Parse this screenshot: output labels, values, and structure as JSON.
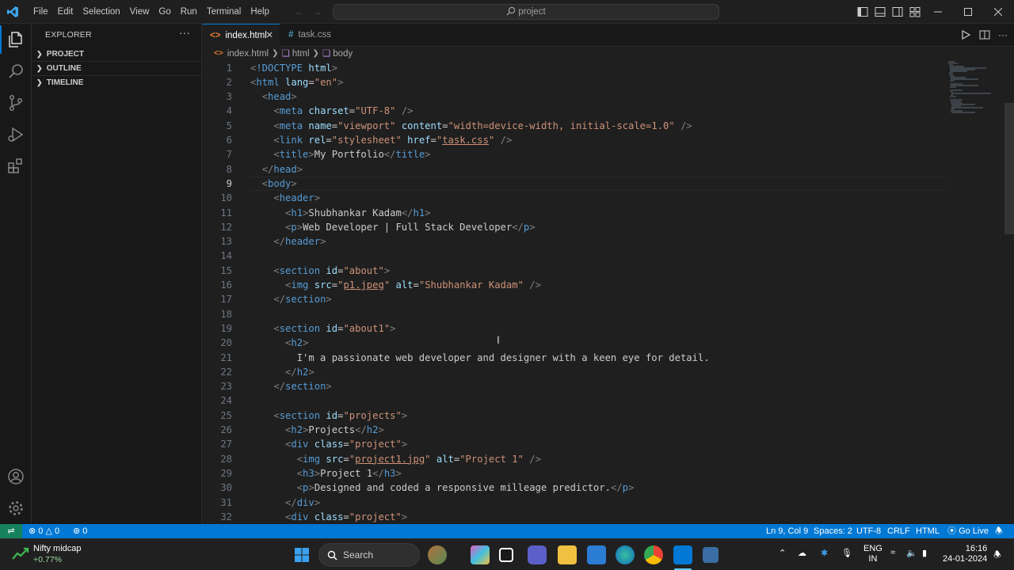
{
  "titlebar": {
    "menu": [
      "File",
      "Edit",
      "Selection",
      "View",
      "Go",
      "Run",
      "Terminal",
      "Help"
    ],
    "search": "project",
    "icons": [
      "vscode-logo",
      "back-arrow-icon",
      "forward-arrow-icon",
      "toggle-sidebar-icon",
      "toggle-panel-icon",
      "toggle-secondary-sidebar-icon",
      "customize-layout-icon",
      "minimize-icon",
      "maximize-icon",
      "close-icon"
    ]
  },
  "activitybar": {
    "items": [
      "explorer-icon",
      "search-icon",
      "source-control-icon",
      "run-debug-icon",
      "extensions-icon"
    ],
    "bottom": [
      "accounts-icon",
      "manage-gear-icon"
    ]
  },
  "sidebar": {
    "title": "EXPLORER",
    "more": "···",
    "sections": [
      "PROJECT",
      "OUTLINE",
      "TIMELINE"
    ]
  },
  "tabs": [
    {
      "label": "index.html",
      "icon": "<>",
      "active": true,
      "close": "✕"
    },
    {
      "label": "task.css",
      "icon": "#",
      "active": false
    }
  ],
  "breadcrumb": [
    "index.html",
    "html",
    "body"
  ],
  "editor": {
    "current_line": 9,
    "lines": [
      [
        [
          "b",
          "<"
        ],
        [
          "t",
          "!DOCTYPE"
        ],
        [
          "p",
          " "
        ],
        [
          "a",
          "html"
        ],
        [
          "b",
          ">"
        ]
      ],
      [
        [
          "b",
          "<"
        ],
        [
          "t",
          "html"
        ],
        [
          "p",
          " "
        ],
        [
          "a",
          "lang"
        ],
        [
          "p",
          "="
        ],
        [
          "s",
          "\"en\""
        ],
        [
          "b",
          ">"
        ]
      ],
      [
        [
          "p",
          "  "
        ],
        [
          "b",
          "<"
        ],
        [
          "t",
          "head"
        ],
        [
          "b",
          ">"
        ]
      ],
      [
        [
          "p",
          "    "
        ],
        [
          "b",
          "<"
        ],
        [
          "t",
          "meta"
        ],
        [
          "p",
          " "
        ],
        [
          "a",
          "charset"
        ],
        [
          "p",
          "="
        ],
        [
          "s",
          "\"UTF-8\""
        ],
        [
          "p",
          " "
        ],
        [
          "b",
          "/>"
        ]
      ],
      [
        [
          "p",
          "    "
        ],
        [
          "b",
          "<"
        ],
        [
          "t",
          "meta"
        ],
        [
          "p",
          " "
        ],
        [
          "a",
          "name"
        ],
        [
          "p",
          "="
        ],
        [
          "s",
          "\"viewport\""
        ],
        [
          "p",
          " "
        ],
        [
          "a",
          "content"
        ],
        [
          "p",
          "="
        ],
        [
          "s",
          "\"width=device-width, initial-scale=1.0\""
        ],
        [
          "p",
          " "
        ],
        [
          "b",
          "/>"
        ]
      ],
      [
        [
          "p",
          "    "
        ],
        [
          "b",
          "<"
        ],
        [
          "t",
          "link"
        ],
        [
          "p",
          " "
        ],
        [
          "a",
          "rel"
        ],
        [
          "p",
          "="
        ],
        [
          "s",
          "\"stylesheet\""
        ],
        [
          "p",
          " "
        ],
        [
          "a",
          "href"
        ],
        [
          "p",
          "="
        ],
        [
          "s",
          "\""
        ],
        [
          "su",
          "task.css"
        ],
        [
          "s",
          "\""
        ],
        [
          "p",
          " "
        ],
        [
          "b",
          "/>"
        ]
      ],
      [
        [
          "p",
          "    "
        ],
        [
          "b",
          "<"
        ],
        [
          "t",
          "title"
        ],
        [
          "b",
          ">"
        ],
        [
          "p",
          "My Portfolio"
        ],
        [
          "b",
          "</"
        ],
        [
          "t",
          "title"
        ],
        [
          "b",
          ">"
        ]
      ],
      [
        [
          "p",
          "  "
        ],
        [
          "b",
          "</"
        ],
        [
          "t",
          "head"
        ],
        [
          "b",
          ">"
        ]
      ],
      [
        [
          "p",
          "  "
        ],
        [
          "b",
          "<"
        ],
        [
          "t",
          "body"
        ],
        [
          "b",
          ">"
        ]
      ],
      [
        [
          "p",
          "    "
        ],
        [
          "b",
          "<"
        ],
        [
          "t",
          "header"
        ],
        [
          "b",
          ">"
        ]
      ],
      [
        [
          "p",
          "      "
        ],
        [
          "b",
          "<"
        ],
        [
          "t",
          "h1"
        ],
        [
          "b",
          ">"
        ],
        [
          "p",
          "Shubhankar Kadam"
        ],
        [
          "b",
          "</"
        ],
        [
          "t",
          "h1"
        ],
        [
          "b",
          ">"
        ]
      ],
      [
        [
          "p",
          "      "
        ],
        [
          "b",
          "<"
        ],
        [
          "t",
          "p"
        ],
        [
          "b",
          ">"
        ],
        [
          "p",
          "Web Developer | Full Stack Developer"
        ],
        [
          "b",
          "</"
        ],
        [
          "t",
          "p"
        ],
        [
          "b",
          ">"
        ]
      ],
      [
        [
          "p",
          "    "
        ],
        [
          "b",
          "</"
        ],
        [
          "t",
          "header"
        ],
        [
          "b",
          ">"
        ]
      ],
      [],
      [
        [
          "p",
          "    "
        ],
        [
          "b",
          "<"
        ],
        [
          "t",
          "section"
        ],
        [
          "p",
          " "
        ],
        [
          "a",
          "id"
        ],
        [
          "p",
          "="
        ],
        [
          "s",
          "\"about\""
        ],
        [
          "b",
          ">"
        ]
      ],
      [
        [
          "p",
          "      "
        ],
        [
          "b",
          "<"
        ],
        [
          "t",
          "img"
        ],
        [
          "p",
          " "
        ],
        [
          "a",
          "src"
        ],
        [
          "p",
          "="
        ],
        [
          "s",
          "\""
        ],
        [
          "su",
          "p1.jpeg"
        ],
        [
          "s",
          "\""
        ],
        [
          "p",
          " "
        ],
        [
          "a",
          "alt"
        ],
        [
          "p",
          "="
        ],
        [
          "s",
          "\"Shubhankar Kadam\""
        ],
        [
          "p",
          " "
        ],
        [
          "b",
          "/>"
        ]
      ],
      [
        [
          "p",
          "    "
        ],
        [
          "b",
          "</"
        ],
        [
          "t",
          "section"
        ],
        [
          "b",
          ">"
        ]
      ],
      [],
      [
        [
          "p",
          "    "
        ],
        [
          "b",
          "<"
        ],
        [
          "t",
          "section"
        ],
        [
          "p",
          " "
        ],
        [
          "a",
          "id"
        ],
        [
          "p",
          "="
        ],
        [
          "s",
          "\"about1\""
        ],
        [
          "b",
          ">"
        ]
      ],
      [
        [
          "p",
          "      "
        ],
        [
          "b",
          "<"
        ],
        [
          "t",
          "h2"
        ],
        [
          "b",
          ">"
        ]
      ],
      [
        [
          "p",
          "        I'm a passionate web developer and designer with a keen eye for detail."
        ]
      ],
      [
        [
          "p",
          "      "
        ],
        [
          "b",
          "</"
        ],
        [
          "t",
          "h2"
        ],
        [
          "b",
          ">"
        ]
      ],
      [
        [
          "p",
          "    "
        ],
        [
          "b",
          "</"
        ],
        [
          "t",
          "section"
        ],
        [
          "b",
          ">"
        ]
      ],
      [],
      [
        [
          "p",
          "    "
        ],
        [
          "b",
          "<"
        ],
        [
          "t",
          "section"
        ],
        [
          "p",
          " "
        ],
        [
          "a",
          "id"
        ],
        [
          "p",
          "="
        ],
        [
          "s",
          "\"projects\""
        ],
        [
          "b",
          ">"
        ]
      ],
      [
        [
          "p",
          "      "
        ],
        [
          "b",
          "<"
        ],
        [
          "t",
          "h2"
        ],
        [
          "b",
          ">"
        ],
        [
          "p",
          "Projects"
        ],
        [
          "b",
          "</"
        ],
        [
          "t",
          "h2"
        ],
        [
          "b",
          ">"
        ]
      ],
      [
        [
          "p",
          "      "
        ],
        [
          "b",
          "<"
        ],
        [
          "t",
          "div"
        ],
        [
          "p",
          " "
        ],
        [
          "a",
          "class"
        ],
        [
          "p",
          "="
        ],
        [
          "s",
          "\"project\""
        ],
        [
          "b",
          ">"
        ]
      ],
      [
        [
          "p",
          "        "
        ],
        [
          "b",
          "<"
        ],
        [
          "t",
          "img"
        ],
        [
          "p",
          " "
        ],
        [
          "a",
          "src"
        ],
        [
          "p",
          "="
        ],
        [
          "s",
          "\""
        ],
        [
          "su",
          "project1.jpg"
        ],
        [
          "s",
          "\""
        ],
        [
          "p",
          " "
        ],
        [
          "a",
          "alt"
        ],
        [
          "p",
          "="
        ],
        [
          "s",
          "\"Project 1\""
        ],
        [
          "p",
          " "
        ],
        [
          "b",
          "/>"
        ]
      ],
      [
        [
          "p",
          "        "
        ],
        [
          "b",
          "<"
        ],
        [
          "t",
          "h3"
        ],
        [
          "b",
          ">"
        ],
        [
          "p",
          "Project 1"
        ],
        [
          "b",
          "</"
        ],
        [
          "t",
          "h3"
        ],
        [
          "b",
          ">"
        ]
      ],
      [
        [
          "p",
          "        "
        ],
        [
          "b",
          "<"
        ],
        [
          "t",
          "p"
        ],
        [
          "b",
          ">"
        ],
        [
          "p",
          "Designed and coded a responsive milleage predictor."
        ],
        [
          "b",
          "</"
        ],
        [
          "t",
          "p"
        ],
        [
          "b",
          ">"
        ]
      ],
      [
        [
          "p",
          "      "
        ],
        [
          "b",
          "</"
        ],
        [
          "t",
          "div"
        ],
        [
          "b",
          ">"
        ]
      ],
      [
        [
          "p",
          "      "
        ],
        [
          "b",
          "<"
        ],
        [
          "t",
          "div"
        ],
        [
          "p",
          " "
        ],
        [
          "a",
          "class"
        ],
        [
          "p",
          "="
        ],
        [
          "s",
          "\"project\""
        ],
        [
          "b",
          ">"
        ]
      ]
    ]
  },
  "statusbar": {
    "remote": "⇌",
    "errors": "0",
    "warnings": "0",
    "ports": "0",
    "position": "Ln 9, Col 9",
    "spaces": "Spaces: 2",
    "encoding": "UTF-8",
    "eol": "CRLF",
    "language": "HTML",
    "golive": "Go Live"
  },
  "taskbar": {
    "widget_title": "Nifty midcap",
    "widget_value": "+0.77%",
    "search": "Search",
    "lang": "ENG",
    "region": "IN",
    "time": "16:16",
    "date": "24-01-2024"
  },
  "colors": {
    "accent": "#0078d4",
    "remote": "#16825d",
    "tag": "#569cd6",
    "attr": "#9cdcfe",
    "string": "#ce9178"
  }
}
